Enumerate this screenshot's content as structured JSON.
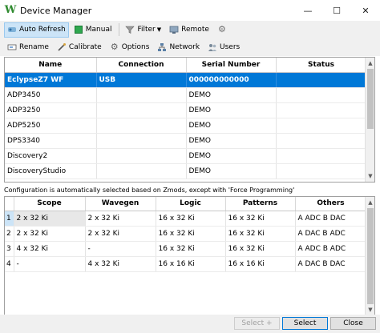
{
  "window": {
    "title": "Device Manager",
    "controls": {
      "minimize": "—",
      "maximize": "☐",
      "close": "✕"
    }
  },
  "toolbar1": {
    "auto_refresh": "Auto Refresh",
    "manual": "Manual",
    "filter": "Filter",
    "remote": "Remote",
    "settings_icon": "gear-icon"
  },
  "toolbar2": {
    "rename": "Rename",
    "calibrate": "Calibrate",
    "options": "Options",
    "network": "Network",
    "users": "Users"
  },
  "devices": {
    "columns": [
      "Name",
      "Connection",
      "Serial Number",
      "Status"
    ],
    "rows": [
      {
        "name": "EclypseZ7 WF",
        "connection": "USB",
        "serial": "000000000000",
        "status": ""
      },
      {
        "name": "ADP3450",
        "connection": "",
        "serial": "DEMO",
        "status": ""
      },
      {
        "name": "ADP3250",
        "connection": "",
        "serial": "DEMO",
        "status": ""
      },
      {
        "name": "ADP5250",
        "connection": "",
        "serial": "DEMO",
        "status": ""
      },
      {
        "name": "DPS3340",
        "connection": "",
        "serial": "DEMO",
        "status": ""
      },
      {
        "name": "Discovery2",
        "connection": "",
        "serial": "DEMO",
        "status": ""
      },
      {
        "name": "DiscoveryStudio",
        "connection": "",
        "serial": "DEMO",
        "status": ""
      }
    ]
  },
  "config_note": "Configuration is automatically selected based on Zmods, except with 'Force Programming'",
  "configs": {
    "columns": [
      "Scope",
      "Wavegen",
      "Logic",
      "Patterns",
      "Others"
    ],
    "rows": [
      {
        "index": "1",
        "scope": "2 x 32 Ki",
        "wavegen": "2 x 32 Ki",
        "logic": "16 x 32 Ki",
        "patterns": "16 x 32 Ki",
        "others": "A ADC B DAC"
      },
      {
        "index": "2",
        "scope": "2 x 32 Ki",
        "wavegen": "2 x 32 Ki",
        "logic": "16 x 32 Ki",
        "patterns": "16 x 32 Ki",
        "others": "A DAC B ADC"
      },
      {
        "index": "3",
        "scope": "4 x 32 Ki",
        "wavegen": "-",
        "logic": "16 x 32 Ki",
        "patterns": "16 x 32 Ki",
        "others": "A ADC B ADC"
      },
      {
        "index": "4",
        "scope": "-",
        "wavegen": "4 x 32 Ki",
        "logic": "16 x 16 Ki",
        "patterns": "16 x 16 Ki",
        "others": "A DAC B DAC"
      }
    ]
  },
  "footer": {
    "select_plus": "Select +",
    "select": "Select",
    "close": "Close"
  }
}
